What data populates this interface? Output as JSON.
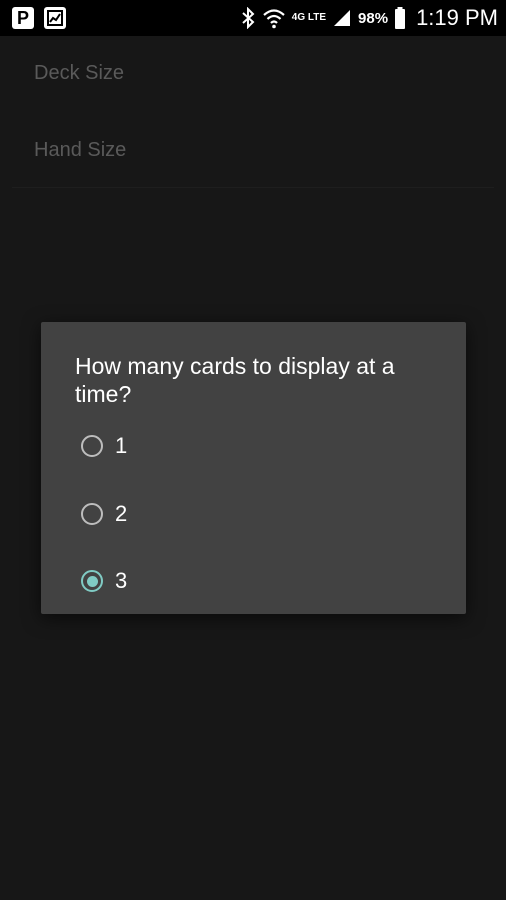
{
  "status_bar": {
    "left_icons": [
      "parking-icon",
      "image-icon"
    ],
    "p_label": "P",
    "right_icons": [
      "bluetooth-icon",
      "wifi-icon",
      "lte-icon",
      "signal-icon",
      "battery-icon"
    ],
    "lte_label": "4G LTE",
    "battery_percent": "98%",
    "time": "1:19 PM"
  },
  "settings": {
    "items": [
      {
        "label": "Deck Size"
      },
      {
        "label": "Hand Size"
      }
    ]
  },
  "dialog": {
    "title": "How many cards to display at a time?",
    "options": [
      {
        "label": "1",
        "selected": false
      },
      {
        "label": "2",
        "selected": false
      },
      {
        "label": "3",
        "selected": true
      }
    ],
    "accent_color": "#80cbc4",
    "background_color": "#424242"
  }
}
